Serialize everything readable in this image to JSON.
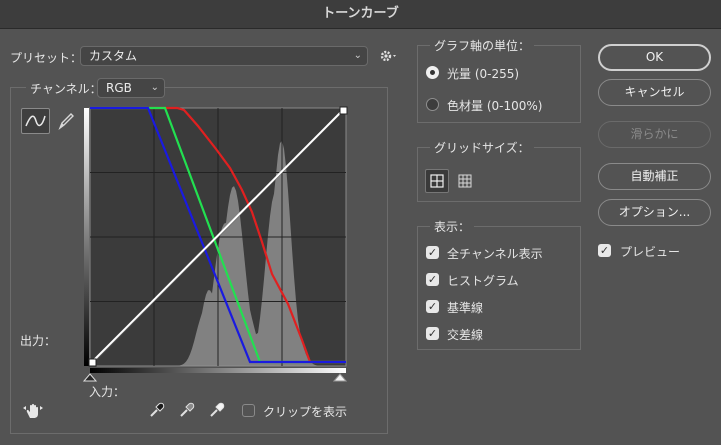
{
  "window": {
    "title": "トーンカーブ"
  },
  "preset": {
    "label": "プリセット：",
    "value": "カスタム"
  },
  "channel": {
    "label": "チャンネル：",
    "value": "RGB"
  },
  "graph": {
    "output_label": "出力：",
    "input_label": "入力：",
    "clip_label": "クリップを表示",
    "clip_checked": false
  },
  "graph_units": {
    "title": "グラフ軸の単位：",
    "options": [
      {
        "label": "光量 (0-255)",
        "selected": true
      },
      {
        "label": "色材量 (0-100%)",
        "selected": false
      }
    ]
  },
  "grid_size": {
    "title": "グリッドサイズ："
  },
  "display": {
    "title": "表示：",
    "options": [
      {
        "label": "全チャンネル表示",
        "checked": true
      },
      {
        "label": "ヒストグラム",
        "checked": true
      },
      {
        "label": "基準線",
        "checked": true
      },
      {
        "label": "交差線",
        "checked": true
      }
    ]
  },
  "buttons": {
    "ok": "OK",
    "cancel": "キャンセル",
    "smooth": "滑らかに",
    "auto": "自動補正",
    "options": "オプション..."
  },
  "preview": {
    "label": "プレビュー",
    "checked": true
  },
  "colors": {
    "background": "#535353",
    "graph_bg": "#3b3b3b",
    "red_curve": "#e02020",
    "green_curve": "#22e050",
    "blue_curve": "#1a1ae0",
    "rgb_curve": "#ffffff",
    "histogram": "#8e8e8e"
  }
}
